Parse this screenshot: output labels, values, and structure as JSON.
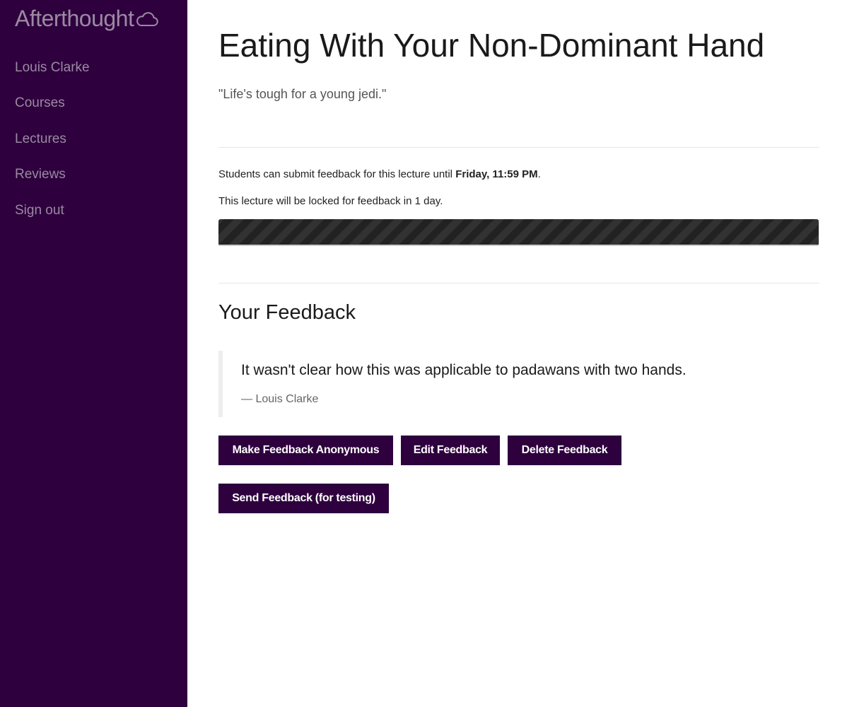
{
  "sidebar": {
    "brand": "Afterthought",
    "brand_icon": "cloud-icon",
    "items": [
      {
        "label": "Louis Clarke"
      },
      {
        "label": "Courses"
      },
      {
        "label": "Lectures"
      },
      {
        "label": "Reviews"
      },
      {
        "label": "Sign out"
      }
    ]
  },
  "main": {
    "title": "Eating With Your Non-Dominant Hand",
    "quote": "\"Life's tough for a young jedi.\"",
    "deadline_prefix": "Students can submit feedback for this lecture until ",
    "deadline_value": "Friday, 11:59 PM",
    "deadline_suffix": ".",
    "locked_text": "This lecture will be locked for feedback in 1 day.",
    "progress_fraction": 1.0,
    "feedback_heading": "Your Feedback",
    "feedback_text": "It wasn't clear how this was applicable to padawans with two hands.",
    "feedback_author": "— Louis Clarke",
    "buttons": {
      "anonymous": "Make Feedback Anonymous",
      "edit": "Edit Feedback",
      "delete": "Delete Feedback",
      "send": "Send Feedback (for testing)"
    }
  },
  "colors": {
    "sidebar_bg": "#2e003e",
    "nav_text": "#9a8aa2",
    "button_bg": "#2e003e",
    "progress_fill": "#222222"
  }
}
